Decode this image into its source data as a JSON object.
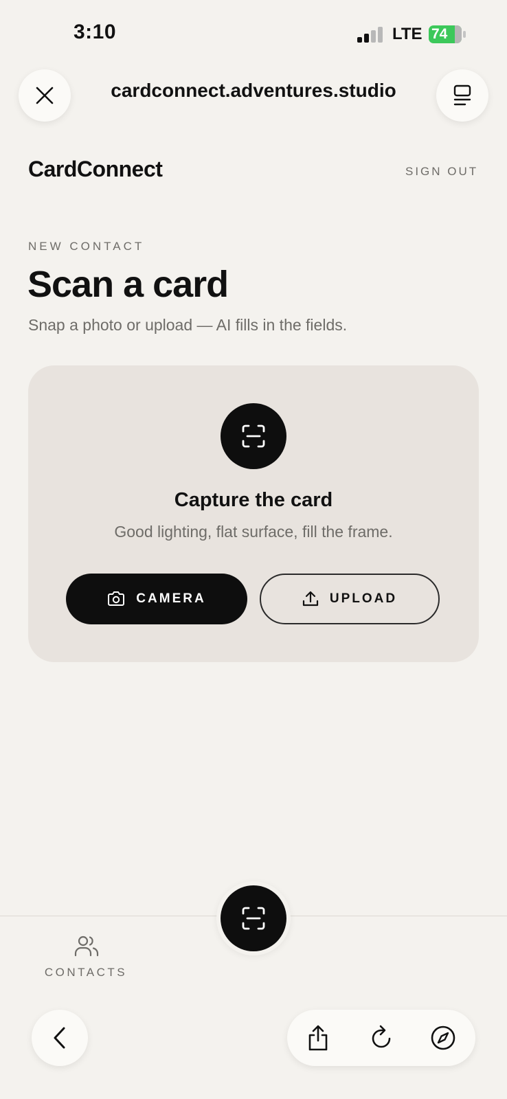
{
  "status_bar": {
    "time": "3:10",
    "network": "LTE",
    "battery": "74"
  },
  "browser": {
    "url": "cardconnect.adventures.studio",
    "icons": [
      "close-icon",
      "tabs-icon",
      "back-icon",
      "share-icon",
      "reload-icon",
      "compass-icon"
    ]
  },
  "header": {
    "brand": "CardConnect",
    "sign_out": "SIGN OUT"
  },
  "page": {
    "eyebrow": "NEW CONTACT",
    "title": "Scan a card",
    "subtitle": "Snap a photo or upload — AI fills in the fields."
  },
  "capture": {
    "title": "Capture the card",
    "subtitle": "Good lighting, flat surface, fill the frame.",
    "camera_label": "CAMERA",
    "upload_label": "UPLOAD"
  },
  "tab_bar": {
    "contacts_label": "CONTACTS"
  },
  "colors": {
    "background": "#f4f2ee",
    "card": "#e8e3de",
    "primary": "#0e0e0e",
    "muted_text": "#6e6c68",
    "battery": "#3cc85a"
  }
}
